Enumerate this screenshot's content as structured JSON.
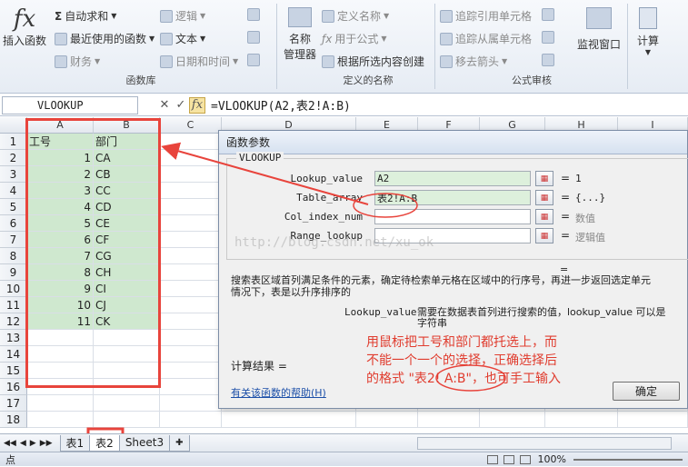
{
  "ribbon": {
    "insert_function": "插入函数",
    "autosum": "自动求和",
    "recent": "最近使用的函数",
    "finance": "财务",
    "logic": "逻辑",
    "text": "文本",
    "datetime": "日期和时间",
    "group_library": "函数库",
    "name_big1": "名称",
    "name_big2": "管理器",
    "define_name": "定义名称",
    "use_in_formula": "用于公式",
    "create_from_sel": "根据所选内容创建",
    "group_names": "定义的名称",
    "trace_prec": "追踪引用单元格",
    "trace_dep": "追踪从属单元格",
    "remove_arrows": "移去箭头",
    "group_audit": "公式审核",
    "watch": "监视窗口",
    "calc": "计算"
  },
  "formula_bar": {
    "name_box": "VLOOKUP",
    "cancel": "✕",
    "enter": "✓",
    "fx": "fx",
    "formula": "=VLOOKUP(A2,表2!A:B)"
  },
  "columns": [
    "A",
    "B",
    "C",
    "D",
    "E",
    "F",
    "G",
    "H",
    "I"
  ],
  "rows": [
    {
      "n": "1",
      "a": "工号",
      "b": "部门"
    },
    {
      "n": "2",
      "a": "1",
      "b": "CA"
    },
    {
      "n": "3",
      "a": "2",
      "b": "CB"
    },
    {
      "n": "4",
      "a": "3",
      "b": "CC"
    },
    {
      "n": "5",
      "a": "4",
      "b": "CD"
    },
    {
      "n": "6",
      "a": "5",
      "b": "CE"
    },
    {
      "n": "7",
      "a": "6",
      "b": "CF"
    },
    {
      "n": "8",
      "a": "7",
      "b": "CG"
    },
    {
      "n": "9",
      "a": "8",
      "b": "CH"
    },
    {
      "n": "10",
      "a": "9",
      "b": "CI"
    },
    {
      "n": "11",
      "a": "10",
      "b": "CJ"
    },
    {
      "n": "12",
      "a": "11",
      "b": "CK"
    },
    {
      "n": "13",
      "a": "",
      "b": ""
    },
    {
      "n": "14",
      "a": "",
      "b": ""
    },
    {
      "n": "15",
      "a": "",
      "b": ""
    },
    {
      "n": "16",
      "a": "",
      "b": ""
    },
    {
      "n": "17",
      "a": "",
      "b": ""
    },
    {
      "n": "18",
      "a": "",
      "b": ""
    }
  ],
  "dialog": {
    "title": "函数参数",
    "fn_name": "VLOOKUP",
    "params": [
      {
        "label": "Lookup_value",
        "value": "A2",
        "eq": "=",
        "result": "1"
      },
      {
        "label": "Table_array",
        "value": "表2!A:B",
        "eq": "=",
        "result": "{...}"
      },
      {
        "label": "Col_index_num",
        "value": "",
        "eq": "=",
        "result": "数值"
      },
      {
        "label": "Range_lookup",
        "value": "",
        "eq": "=",
        "result": "逻辑值"
      }
    ],
    "eq_line": "=",
    "desc1": "搜索表区域首列满足条件的元素，确定待检索单元格在区域中的行序号，再进一步返回选定单元",
    "desc2": "情况下，表是以升序排序的",
    "arg_name": "Lookup_value",
    "arg_desc1": "需要在数据表首列进行搜索的值，lookup_value 可以是",
    "arg_desc2": "字符串",
    "calc_result": "计算结果 =",
    "help_link": "有关该函数的帮助(H)",
    "ok": "确定"
  },
  "watermark": "http://blog.csdn.net/xu_ok",
  "annotation": [
    "用鼠标把工号和部门都托选上，而",
    "不能一个一个的选择，正确选择后",
    "的格式 \"表2! A:B\"，也可手工输入"
  ],
  "sheets": [
    "表1",
    "表2",
    "Sheet3"
  ],
  "status": {
    "mode": "点",
    "zoom": "100%"
  },
  "colors": {
    "red": "#e8443c",
    "selection": "#cfe8cf"
  }
}
